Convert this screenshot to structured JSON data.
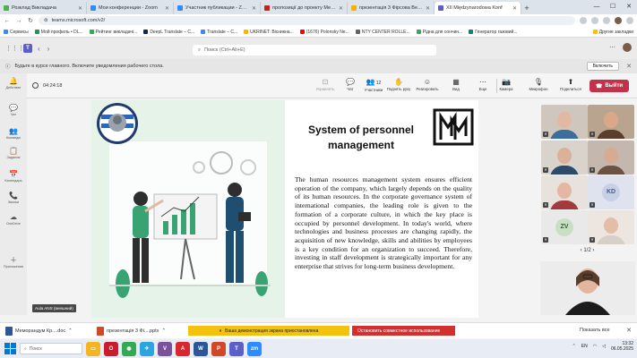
{
  "browser": {
    "tabs": [
      {
        "label": "Розклад Викладача",
        "color": "#4caf50"
      },
      {
        "label": "Мои конференции - Zoom",
        "color": "#2d8cff"
      },
      {
        "label": "Участник публикации - Zoom",
        "color": "#2d8cff"
      },
      {
        "label": "пропозиції до проекту Мемо",
        "color": "#c5221f"
      },
      {
        "label": "презентація 3 Фірсова Веро",
        "color": "#f4b400"
      },
      {
        "label": "XII Międzynarodowa Konf",
        "color": "#5b5fc7",
        "active": true
      }
    ],
    "new_tab": "+",
    "address": "teams.microsoft.com/v2/",
    "bookmarks": [
      {
        "label": "Сервисы",
        "color": "#4285f4"
      },
      {
        "label": "Мой профиль • DL...",
        "color": "#0f9d58"
      },
      {
        "label": "Рейтинг викладачі...",
        "color": "#34a853"
      },
      {
        "label": "DeepL Translate – С...",
        "color": "#0f2b46"
      },
      {
        "label": "Translate – C...",
        "color": "#4285f4"
      },
      {
        "label": "UKRINET: Вісникна...",
        "color": "#ffb300"
      },
      {
        "label": "(1676) Polonsky Ne...",
        "color": "#ff0000"
      },
      {
        "label": "NTY CENTER ROLLE...",
        "color": "#5f6368"
      },
      {
        "label": "Рідна для сончин...",
        "color": "#34a853"
      },
      {
        "label": "Генератор газовий...",
        "color": "#00897b"
      }
    ],
    "bookmarks_other": "Другие закладки"
  },
  "teams": {
    "search_placeholder": "Поиск (Ctrl+Alt+E)",
    "notification": "Будьте в курсе главного. Включите уведомления рабочего стола.",
    "notification_button": "Включить",
    "rail": [
      {
        "label": "Действие",
        "icon": "bell-icon",
        "glyph": "🔔"
      },
      {
        "label": "Чат",
        "icon": "chat-icon",
        "glyph": "💬"
      },
      {
        "label": "Команды",
        "icon": "teams-icon",
        "glyph": "👥"
      },
      {
        "label": "Задания",
        "icon": "assignments-icon",
        "glyph": "📋"
      },
      {
        "label": "Календарь",
        "icon": "calendar-icon",
        "glyph": "📅"
      },
      {
        "label": "Звонки",
        "icon": "phone-icon",
        "glyph": "📞"
      },
      {
        "label": "OneDrive",
        "icon": "cloud-icon",
        "glyph": "☁"
      },
      {
        "label": "Приложения",
        "icon": "apps-icon",
        "glyph": "＋"
      }
    ],
    "meeting": {
      "timer": "04:24:18",
      "tools": [
        {
          "label": "Управлять",
          "icon": "manage-icon",
          "glyph": "⊡",
          "dim": true
        },
        {
          "label": "Чат",
          "icon": "chat-icon",
          "glyph": "💬"
        },
        {
          "label": "Участники",
          "icon": "people-icon",
          "glyph": "👥",
          "count": "12"
        },
        {
          "label": "Поднять руку",
          "icon": "raise-hand-icon",
          "glyph": "✋"
        },
        {
          "label": "Реагировать",
          "icon": "react-icon",
          "glyph": "☺"
        },
        {
          "label": "Вид",
          "icon": "view-icon",
          "glyph": "▦"
        },
        {
          "label": "Еще",
          "icon": "more-icon",
          "glyph": "⋯"
        }
      ],
      "av": [
        {
          "label": "Камера",
          "icon": "camera-off-icon",
          "glyph": "📷"
        },
        {
          "label": "Микрофон",
          "icon": "mic-off-icon",
          "glyph": "🎙"
        },
        {
          "label": "Поделиться",
          "icon": "share-icon",
          "glyph": "⬆"
        }
      ],
      "leave": "Выйти"
    },
    "presenter_label": "Aula ANS (внешний)",
    "pager": "1/2"
  },
  "slide": {
    "title": "System of personnel management",
    "body": "The human resources management system ensures efficient operation of the company, which largely depends on the quality of its human resources. In the corporate governance system of international companies, the leading role is given to the formation of a corporate culture, in which the key place is occupied by personnel development. In today's world, where technologies and business processes are changing rapidly, the acquisition of new knowledge, skills and abilities by employees is a key condition for an organization to succeed. Therefore, investing in staff development is strategically important for any enterprise that strives for long-term business development."
  },
  "participants": [
    {
      "initials": "",
      "bg": "#cfc6bd",
      "face": "#e0b9a0",
      "shirt": "#3e6d9c"
    },
    {
      "initials": "",
      "bg": "#b9a58f",
      "face": "#d9a88b",
      "shirt": "#5a3d2b"
    },
    {
      "initials": "",
      "bg": "#d8d4cc",
      "face": "#dcb199",
      "shirt": "#2d4a6b"
    },
    {
      "initials": "",
      "bg": "#c3b7ae",
      "face": "#d7ab92",
      "shirt": "#6b5344"
    },
    {
      "initials": "",
      "bg": "#e7e2dc",
      "face": "#e3b7a1",
      "shirt": "#a23c3c"
    },
    {
      "initials": "KD",
      "bg": "#dfe3ee",
      "fg": "#4a5a8a",
      "circle": "#c8d0e6"
    },
    {
      "initials": "ZV",
      "bg": "#e9e9e9",
      "fg": "#3c5a36",
      "circle": "#c9dfc4"
    },
    {
      "initials": "",
      "bg": "#ede6e0",
      "face": "#e5bca5",
      "shirt": "#d7d0c8"
    }
  ],
  "downloads": [
    {
      "label": "Меморандум Кр....doc",
      "color": "#2b579a"
    },
    {
      "label": "презентація 3 Фі....pptx",
      "color": "#d24726"
    }
  ],
  "sharing": {
    "message": "Ваша демонстрация экрана приостановлена",
    "stop": "Остановить совместное использование",
    "show_all": "Показать все"
  },
  "taskbar": {
    "search_placeholder": "Поиск",
    "apps": [
      {
        "icon": "files-icon",
        "color": "#f3b61f",
        "glyph": "▭"
      },
      {
        "icon": "opera-icon",
        "color": "#cc1b2b",
        "glyph": "O"
      },
      {
        "icon": "chrome-icon",
        "color": "#34a853",
        "glyph": "◉"
      },
      {
        "icon": "telegram-icon",
        "color": "#2aa5e0",
        "glyph": "✈"
      },
      {
        "icon": "viber-icon",
        "color": "#7b519d",
        "glyph": "V"
      },
      {
        "icon": "acrobat-icon",
        "color": "#d9272e",
        "glyph": "A"
      },
      {
        "icon": "word-icon",
        "color": "#2b579a",
        "glyph": "W"
      },
      {
        "icon": "powerpoint-icon",
        "color": "#d24726",
        "glyph": "P"
      },
      {
        "icon": "teams-icon",
        "color": "#5b5fc7",
        "glyph": "T"
      },
      {
        "icon": "zoom-icon",
        "color": "#2d8cff",
        "glyph": "zm"
      }
    ],
    "lang": "EN",
    "time": "13:32",
    "date": "06.05.2025"
  }
}
